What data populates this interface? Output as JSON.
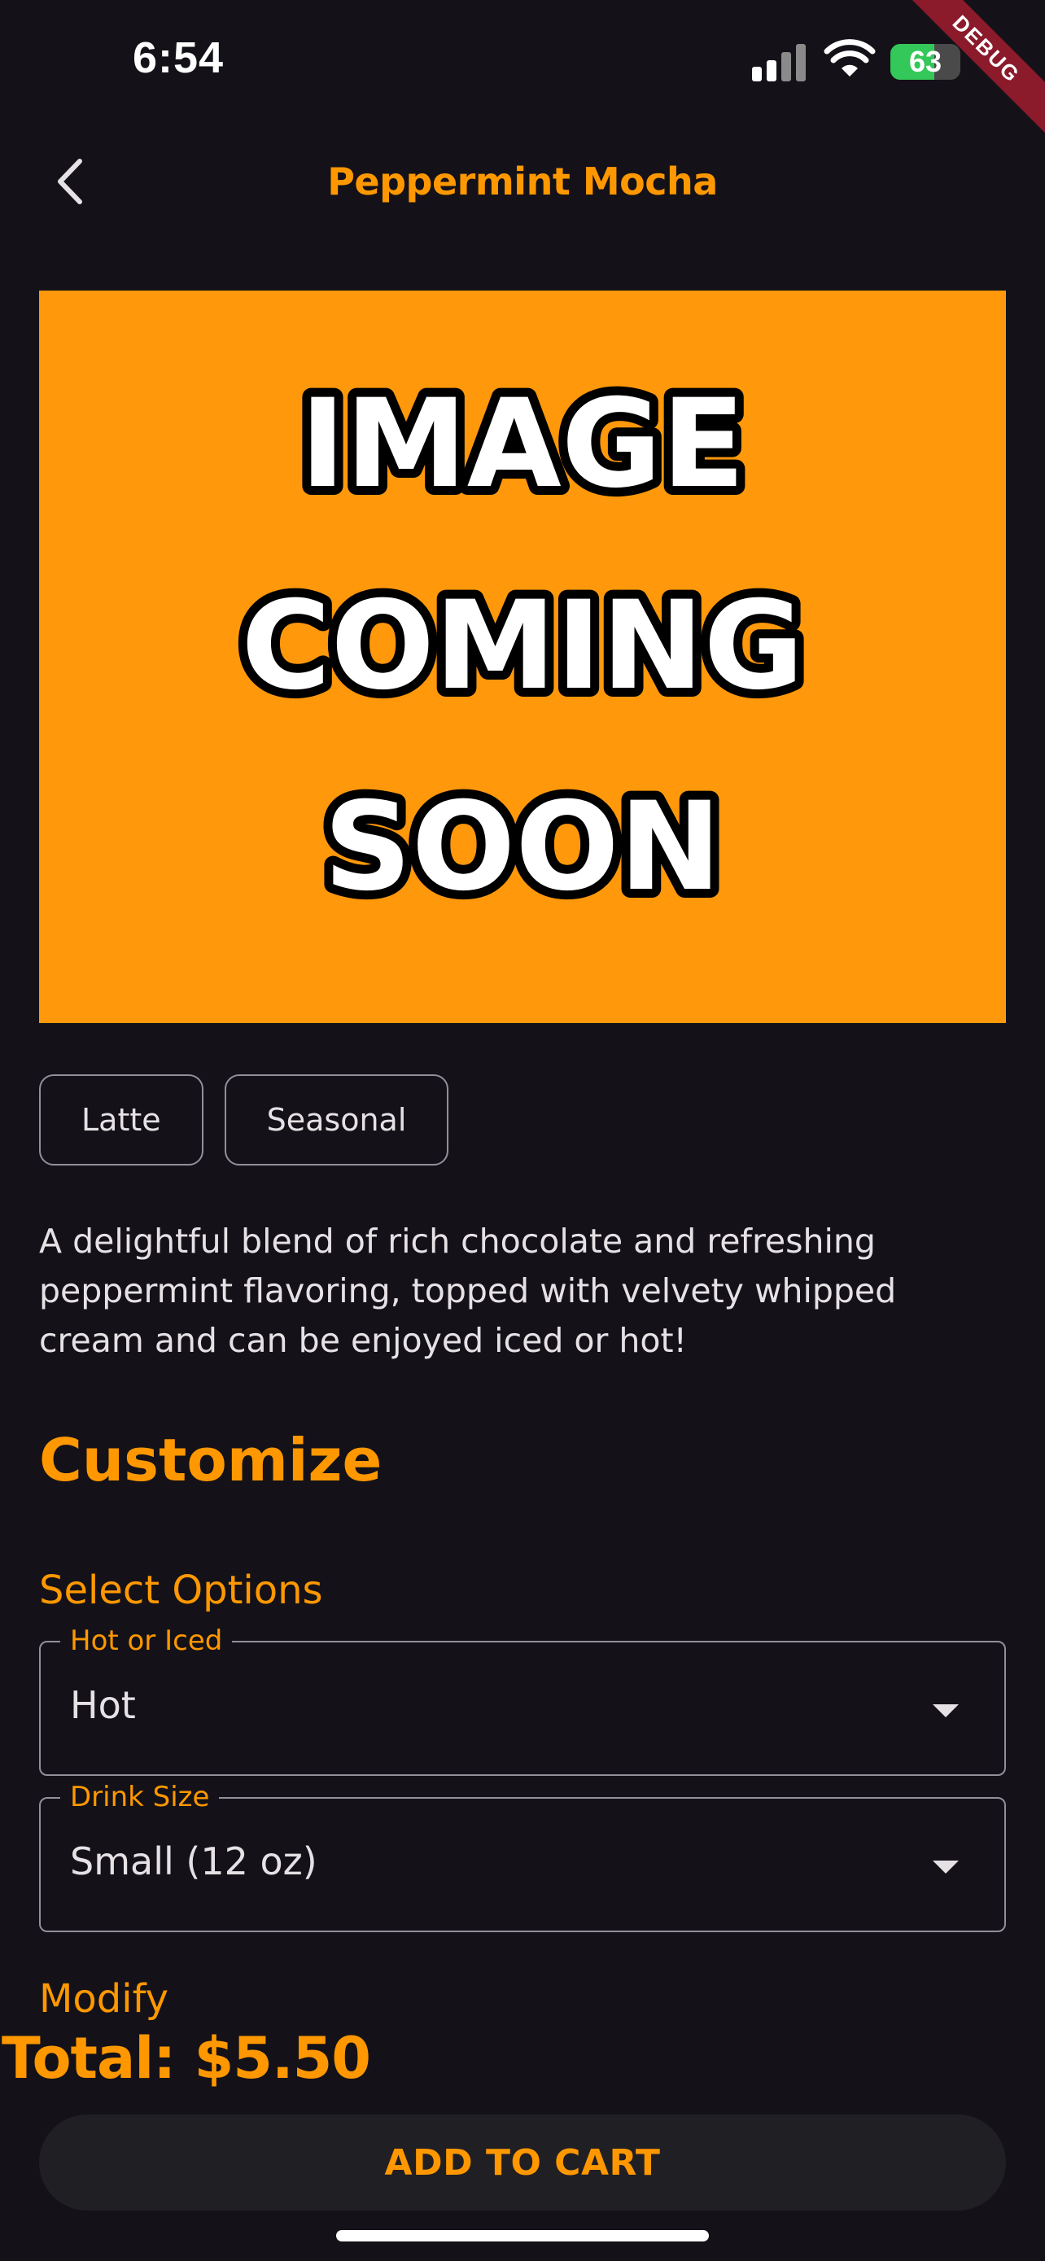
{
  "status_bar": {
    "time": "6:54",
    "battery_percent": "63",
    "battery_level": 0.63,
    "charging": true
  },
  "debug_banner": "DEBUG",
  "app_bar": {
    "title": "Peppermint Mocha",
    "back_icon": "chevron-left-icon"
  },
  "hero_image": {
    "lines": [
      "IMAGE",
      "COMING",
      "SOON"
    ],
    "background": "#FF980A"
  },
  "tags": [
    "Latte",
    "Seasonal"
  ],
  "description": "A delightful blend of rich chocolate and refreshing peppermint flavoring, topped with velvety whipped cream and can be enjoyed iced or hot!",
  "customize": {
    "heading": "Customize",
    "select_options_label": "Select Options",
    "fields": [
      {
        "label": "Hot or Iced",
        "value": "Hot"
      },
      {
        "label": "Drink Size",
        "value": "Small (12 oz)"
      }
    ],
    "modify_label": "Modify"
  },
  "total": "Total: $5.50",
  "add_to_cart_label": "ADD TO CART",
  "colors": {
    "background": "#141218",
    "accent": "#FF9800",
    "outline": "#938F99",
    "button_surface": "#201F24"
  }
}
